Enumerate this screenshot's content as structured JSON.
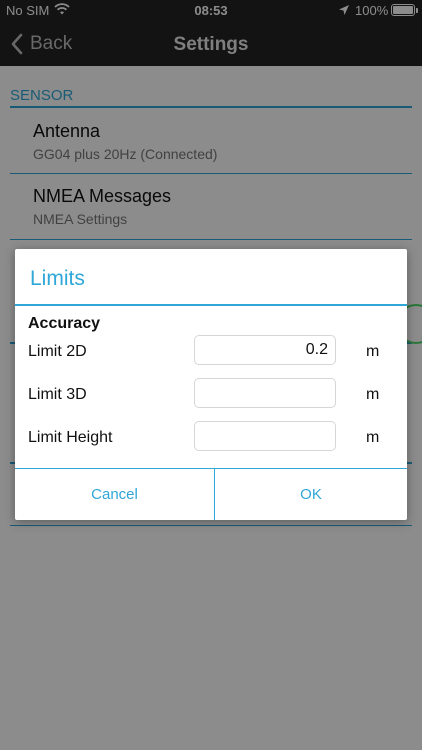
{
  "status_bar": {
    "carrier": "No SIM",
    "time": "08:53",
    "battery": "100%"
  },
  "nav": {
    "back_label": "Back",
    "title": "Settings"
  },
  "list": {
    "section_sensor": "SENSOR",
    "items": [
      {
        "title": "Antenna",
        "subtitle": "GG04 plus 20Hz (Connected)"
      },
      {
        "title": "NMEA Messages",
        "subtitle": "NMEA Settings"
      }
    ]
  },
  "dialog": {
    "title": "Limits",
    "section": "Accuracy",
    "fields": [
      {
        "label": "Limit 2D",
        "value": "0.2",
        "unit": "m"
      },
      {
        "label": "Limit 3D",
        "value": "",
        "unit": "m"
      },
      {
        "label": "Limit Height",
        "value": "",
        "unit": "m"
      }
    ],
    "cancel_label": "Cancel",
    "ok_label": "OK"
  },
  "colors": {
    "accent": "#2fa7d8",
    "toggle": "#4cd964"
  }
}
